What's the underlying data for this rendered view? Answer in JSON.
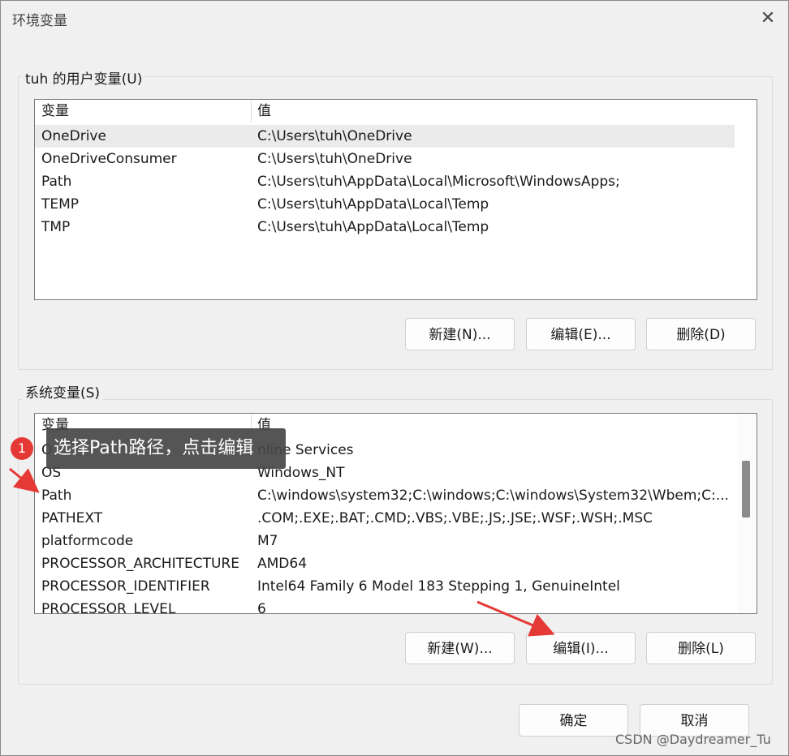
{
  "window": {
    "title": "环境变量",
    "close_icon": "✕"
  },
  "user_vars": {
    "group_label": "tuh 的用户变量(U)",
    "columns": {
      "name": "变量",
      "value": "值"
    },
    "rows": [
      {
        "name": "OneDrive",
        "value": "C:\\Users\\tuh\\OneDrive"
      },
      {
        "name": "OneDriveConsumer",
        "value": "C:\\Users\\tuh\\OneDrive"
      },
      {
        "name": "Path",
        "value": "C:\\Users\\tuh\\AppData\\Local\\Microsoft\\WindowsApps;"
      },
      {
        "name": "TEMP",
        "value": "C:\\Users\\tuh\\AppData\\Local\\Temp"
      },
      {
        "name": "TMP",
        "value": "C:\\Users\\tuh\\AppData\\Local\\Temp"
      }
    ],
    "buttons": {
      "new": "新建(N)...",
      "edit": "编辑(E)...",
      "delete": "删除(D)"
    }
  },
  "system_vars": {
    "group_label": "系统变量(S)",
    "columns": {
      "name": "变量",
      "value": "值"
    },
    "rows": [
      {
        "name": "O",
        "value": "nline Services"
      },
      {
        "name": "OS",
        "value": "Windows_NT"
      },
      {
        "name": "Path",
        "value": "C:\\windows\\system32;C:\\windows;C:\\windows\\System32\\Wbem;C:..."
      },
      {
        "name": "PATHEXT",
        "value": ".COM;.EXE;.BAT;.CMD;.VBS;.VBE;.JS;.JSE;.WSF;.WSH;.MSC"
      },
      {
        "name": "platformcode",
        "value": "M7"
      },
      {
        "name": "PROCESSOR_ARCHITECTURE",
        "value": "AMD64"
      },
      {
        "name": "PROCESSOR_IDENTIFIER",
        "value": "Intel64 Family 6 Model 183 Stepping 1, GenuineIntel"
      },
      {
        "name": "PROCESSOR_LEVEL",
        "value": "6"
      }
    ],
    "buttons": {
      "new": "新建(W)...",
      "edit": "编辑(I)...",
      "delete": "删除(L)"
    }
  },
  "footer": {
    "ok": "确定",
    "cancel": "取消"
  },
  "annotation": {
    "step": "1",
    "text": "选择Path路径，点击编辑",
    "arrow_color": "#e53935"
  },
  "watermark": "CSDN @Daydreamer_Tu"
}
